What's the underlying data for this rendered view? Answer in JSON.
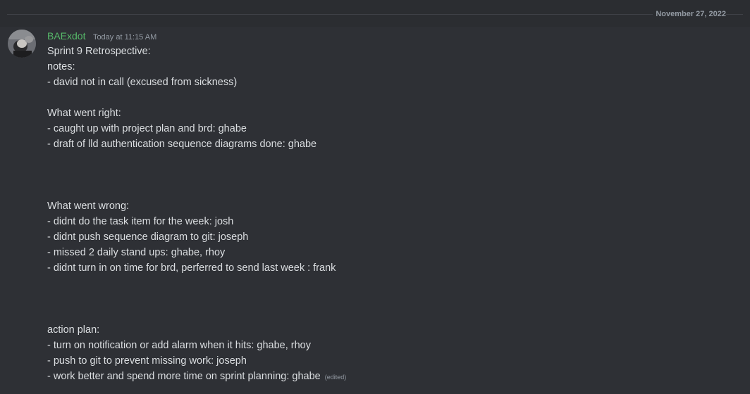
{
  "divider": {
    "date": "November 27, 2022"
  },
  "message": {
    "username": "BAExdot",
    "timestamp": "Today at 11:15 AM",
    "edited_label": "(edited)",
    "lines": [
      "Sprint 9 Retrospective:",
      "notes:",
      "- david not in call (excused from sickness)",
      "",
      "What went right:",
      "- caught up with project plan and brd: ghabe",
      "- draft of lld authentication sequence diagrams done: ghabe",
      "",
      "",
      "",
      "What went wrong:",
      "- didnt do the task item for the week: josh",
      "- didnt push sequence diagram to git: joseph",
      "- missed 2 daily stand ups: ghabe, rhoy",
      "- didnt turn in on time for brd, perferred to send last week : frank",
      "",
      "",
      "",
      "action plan:",
      "- turn on notification or add alarm when it hits: ghabe, rhoy",
      "- push to git to prevent missing work: joseph",
      "- work better and spend more time on sprint planning: ghabe"
    ]
  },
  "colors": {
    "background": "#313338",
    "username": "#57ba6a",
    "text": "#dbdee1",
    "muted": "#949ba4"
  }
}
